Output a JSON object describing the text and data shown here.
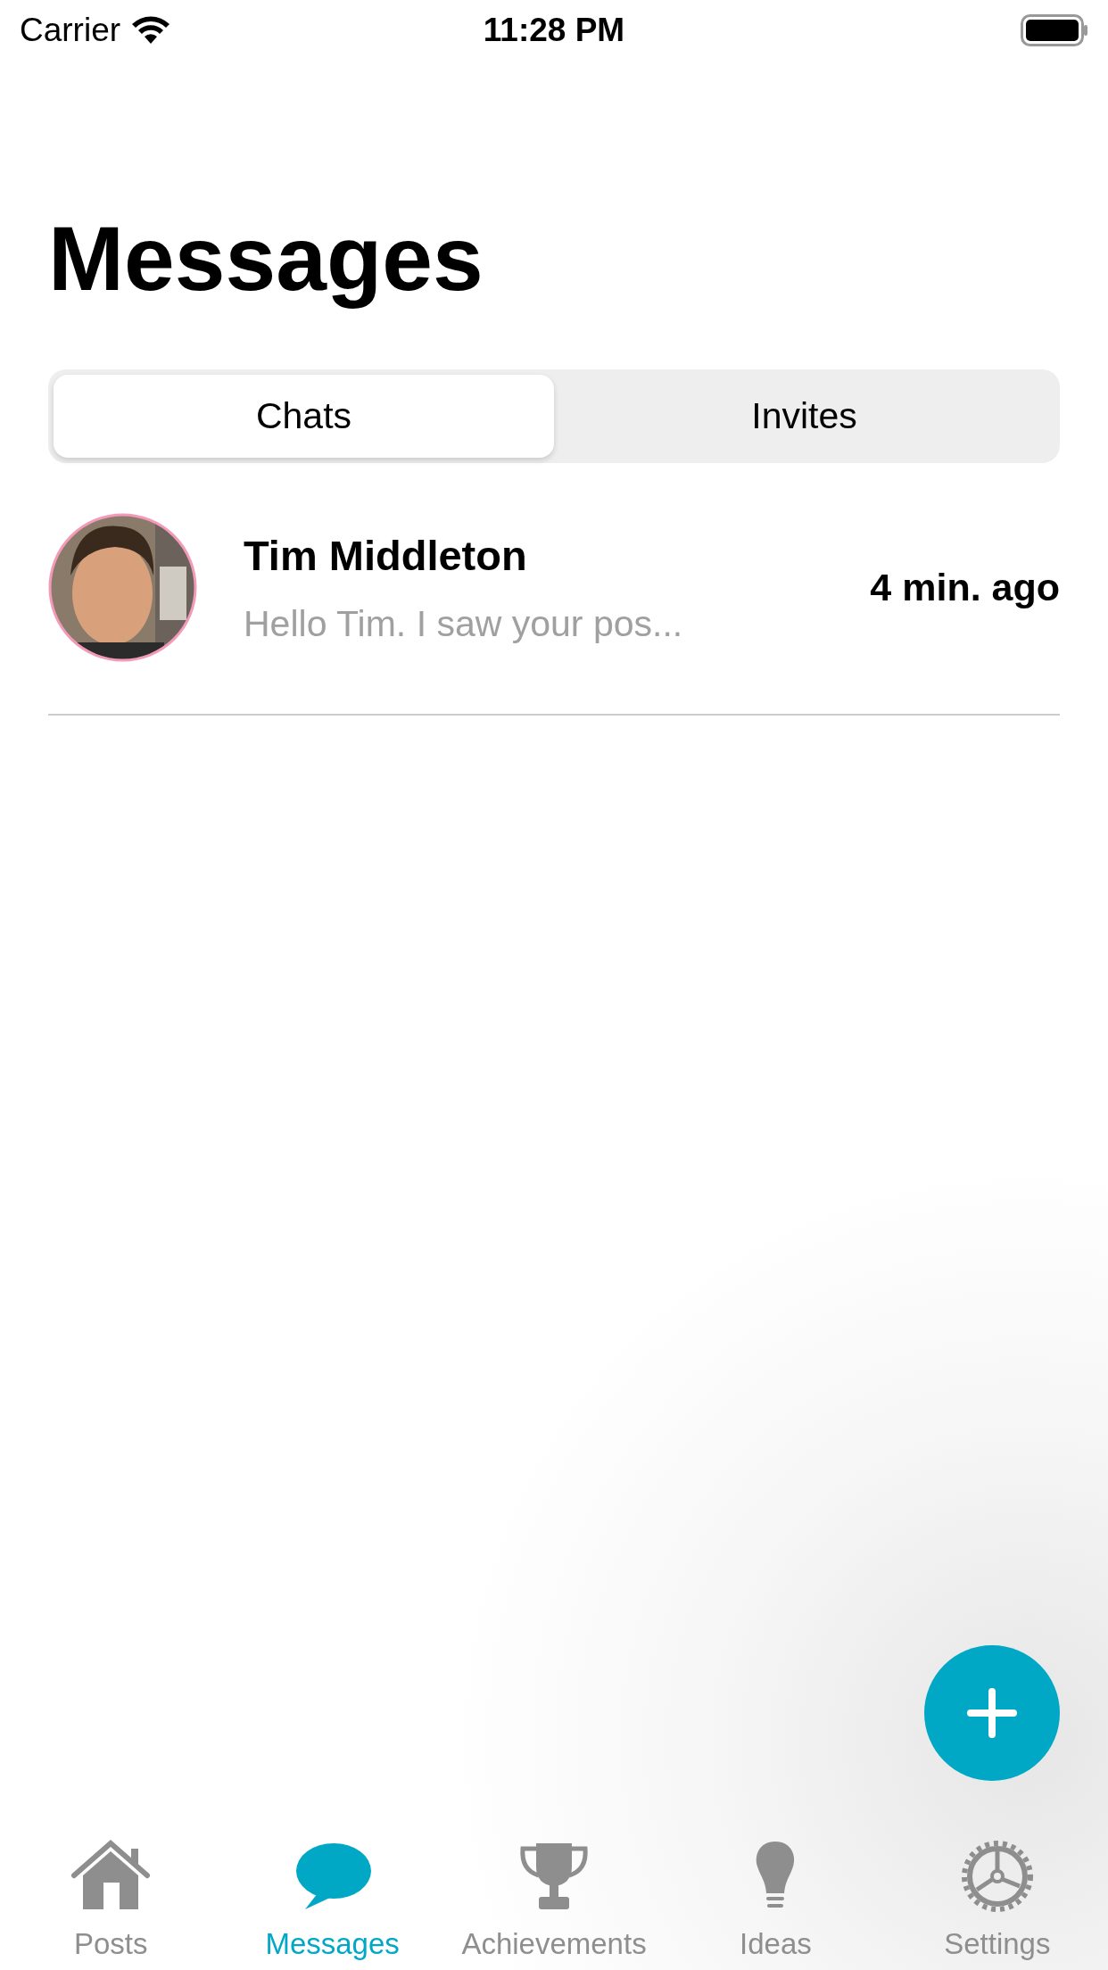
{
  "status_bar": {
    "carrier": "Carrier",
    "time": "11:28 PM"
  },
  "title": "Messages",
  "segments": [
    {
      "label": "Chats",
      "selected": true
    },
    {
      "label": "Invites",
      "selected": false
    }
  ],
  "chats": [
    {
      "name": "Tim Middleton",
      "preview": "Hello Tim. I saw your pos...",
      "time": "4 min. ago"
    }
  ],
  "tab_bar": [
    {
      "label": "Posts",
      "selected": false
    },
    {
      "label": "Messages",
      "selected": true
    },
    {
      "label": "Achievements",
      "selected": false
    },
    {
      "label": "Ideas",
      "selected": false
    },
    {
      "label": "Settings",
      "selected": false
    }
  ]
}
